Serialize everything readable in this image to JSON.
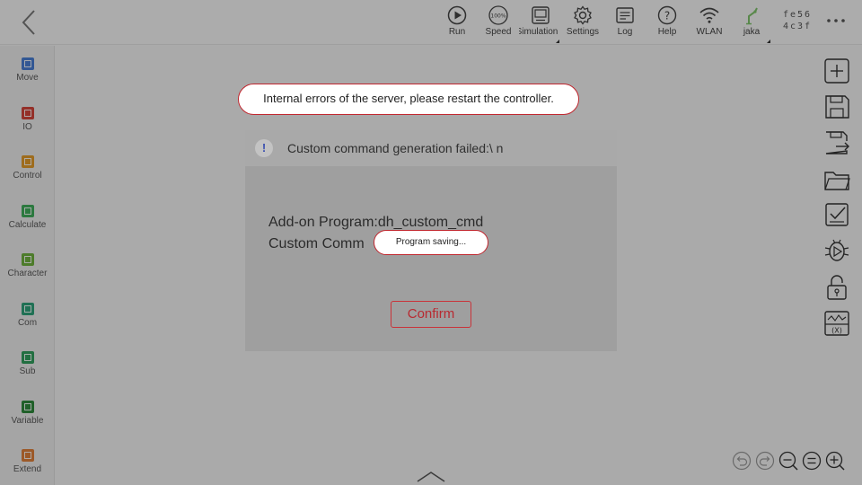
{
  "topbar": {
    "items": [
      {
        "label": "Run",
        "icon": "run-icon"
      },
      {
        "label": "Speed",
        "icon": "speed-icon"
      },
      {
        "label": "Simulation",
        "icon": "simulation-icon"
      },
      {
        "label": "Settings",
        "icon": "gear-icon"
      },
      {
        "label": "Log",
        "icon": "log-icon"
      },
      {
        "label": "Help",
        "icon": "help-icon"
      },
      {
        "label": "WLAN",
        "icon": "wifi-icon"
      },
      {
        "label": "jaka",
        "icon": "robot-arm-icon"
      }
    ],
    "speed_value": "100%",
    "device_id_line1": "fe56",
    "device_id_line2": "4c3f"
  },
  "sidebar": {
    "items": [
      {
        "label": "Move",
        "color": "#4a7fd4"
      },
      {
        "label": "IO",
        "color": "#d4463c"
      },
      {
        "label": "Control",
        "color": "#e39b2a"
      },
      {
        "label": "Calculate",
        "color": "#3fae5b"
      },
      {
        "label": "Character",
        "color": "#6fb23e"
      },
      {
        "label": "Com",
        "color": "#2fa37a"
      },
      {
        "label": "Sub",
        "color": "#31a05e"
      },
      {
        "label": "Variable",
        "color": "#2f8a3c"
      },
      {
        "label": "Extend",
        "color": "#e0803a"
      }
    ]
  },
  "right_toolbar": [
    "add-icon",
    "save-icon",
    "save-as-icon",
    "folder-icon",
    "checklist-icon",
    "debug-icon",
    "lock-icon",
    "variable-monitor-icon"
  ],
  "zoom_controls": [
    "undo-icon",
    "redo-icon",
    "zoom-out-icon",
    "zoom-reset-icon",
    "zoom-in-icon"
  ],
  "error_toast": {
    "text": "Internal errors of the server, please restart the controller."
  },
  "dialog": {
    "title": "Custom command generation failed:\\ n",
    "line1": "Add-on Program:dh_custom_cmd",
    "line2": "Custom Comm",
    "confirm_label": "Confirm"
  },
  "saving_toast": {
    "text": "Program saving..."
  },
  "colors": {
    "accent": "#c0262e",
    "overlay": "rgba(0,0,0,0.30)"
  }
}
